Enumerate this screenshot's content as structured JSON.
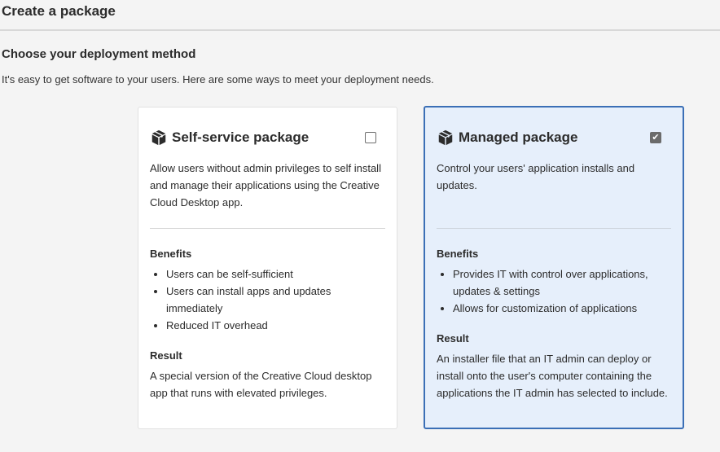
{
  "page": {
    "title": "Create a package",
    "section_heading": "Choose your deployment method",
    "section_description": "It's easy to get software to your users. Here are some ways to meet your deployment needs."
  },
  "cards": {
    "self_service": {
      "icon": "package-icon",
      "title": "Self-service package",
      "checked": false,
      "description": "Allow users without admin privileges to self install and manage their applications using the Creative Cloud Desktop app.",
      "benefits_label": "Benefits",
      "benefits": [
        "Users can be self-sufficient",
        "Users can install apps and updates immediately",
        "Reduced IT overhead"
      ],
      "result_label": "Result",
      "result": "A special version of the Creative Cloud desktop app that runs with elevated privileges."
    },
    "managed": {
      "icon": "package-icon",
      "title": "Managed package",
      "checked": true,
      "checkmark": "✔",
      "description": "Control your users' application installs and updates.",
      "benefits_label": "Benefits",
      "benefits": [
        "Provides IT with control over applications, updates & settings",
        "Allows for customization of applications"
      ],
      "result_label": "Result",
      "result": "An installer file that an IT admin can deploy or install onto the user's computer containing the applications the IT admin has selected to include."
    }
  },
  "colors": {
    "selected_border": "#3b6fb6",
    "selected_background": "#e6effb",
    "page_background": "#f4f4f4"
  }
}
